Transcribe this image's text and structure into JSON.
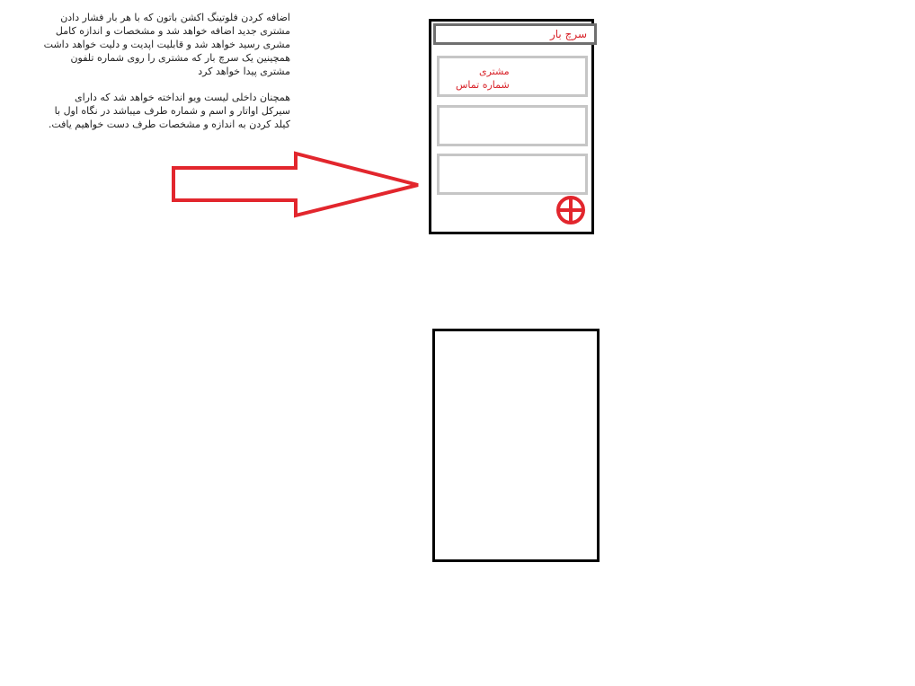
{
  "notes": {
    "paragraph1": "اضافه کردن فلوتینگ اکشن باتون که با هر بار فشار دادن مشتری جدید اضافه خواهد شد و مشخصات و اندازه کامل مشری رسید خواهد شد و قابلیت اپدیت و دلیت خواهد داشت همچینین یک سرچ بار که مشتری را روی شماره تلفون مشتری پیدا خواهد کرد",
    "paragraph2": "همچنان داخلی لیست ویو انداخته خواهد شد که دارای سیرکل اواتار و اسم و شماره طرف میباشد در نگاه اول با کیلد کردن به اندازه و مشخصات طرف دست خواهیم یافت."
  },
  "phone": {
    "search_label": "سرچ بار",
    "cards": [
      {
        "name": "مشتری",
        "phone": "شماره تماس"
      },
      {
        "name": "",
        "phone": ""
      },
      {
        "name": "",
        "phone": ""
      }
    ],
    "fab_icon": "add-circle-icon"
  },
  "colors": {
    "accent": "#d8232a",
    "frame": "#000000",
    "search_border": "#6f6f6f",
    "card_border": "#c6c6c6"
  }
}
